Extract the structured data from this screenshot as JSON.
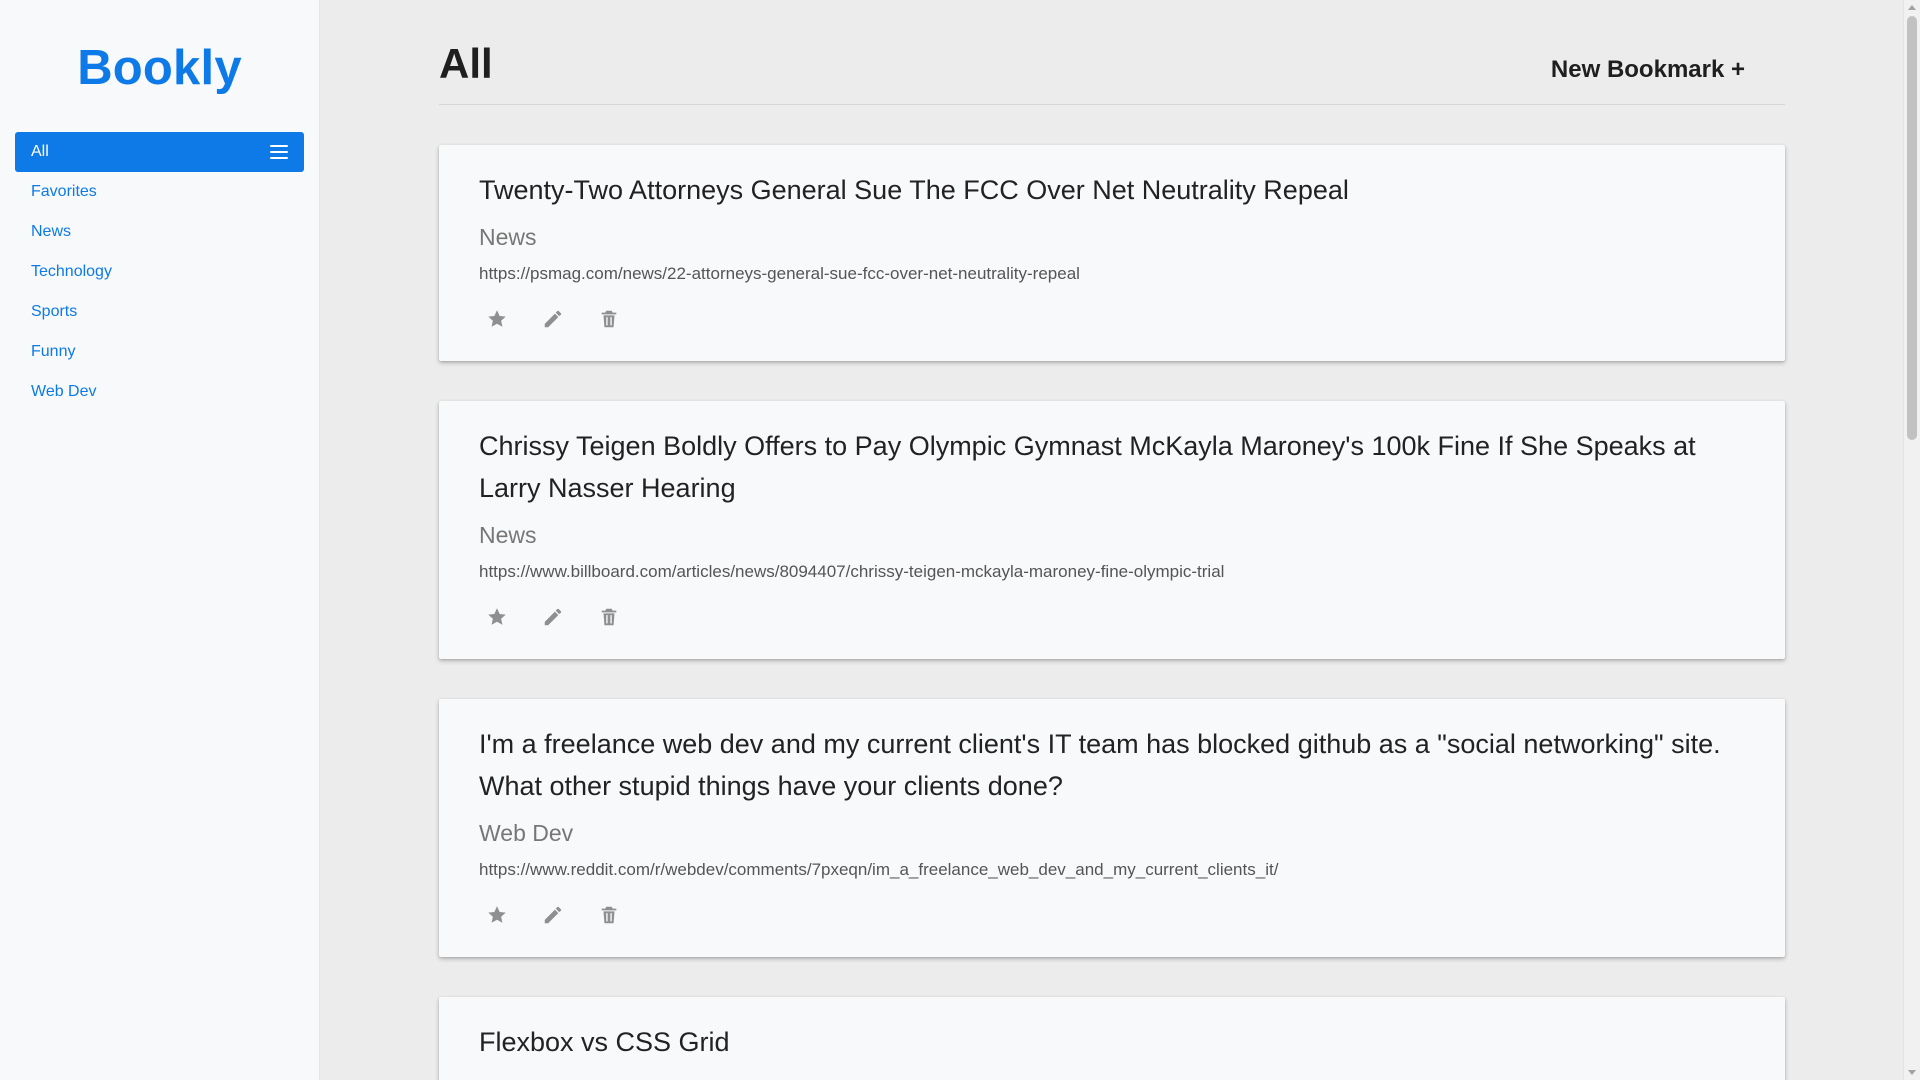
{
  "brand": "Bookly",
  "nav": {
    "items": [
      {
        "label": "All",
        "active": true
      },
      {
        "label": "Favorites"
      },
      {
        "label": "News"
      },
      {
        "label": "Technology"
      },
      {
        "label": "Sports"
      },
      {
        "label": "Funny"
      },
      {
        "label": "Web Dev"
      }
    ]
  },
  "header": {
    "title": "All",
    "new_bookmark": "New Bookmark +"
  },
  "bookmarks": [
    {
      "title": "Twenty-Two Attorneys General Sue The FCC Over Net Neutrality Repeal",
      "category": "News",
      "url": "https://psmag.com/news/22-attorneys-general-sue-fcc-over-net-neutrality-repeal"
    },
    {
      "title": "Chrissy Teigen Boldly Offers to Pay Olympic Gymnast McKayla Maroney's 100k Fine If She Speaks at Larry Nasser Hearing",
      "category": "News",
      "url": "https://www.billboard.com/articles/news/8094407/chrissy-teigen-mckayla-maroney-fine-olympic-trial"
    },
    {
      "title": "I'm a freelance web dev and my current client's IT team has blocked github as a \"social networking\" site. What other stupid things have your clients done?",
      "category": "Web Dev",
      "url": "https://www.reddit.com/r/webdev/comments/7pxeqn/im_a_freelance_web_dev_and_my_current_clients_it/"
    },
    {
      "title": "Flexbox vs CSS Grid",
      "category": "",
      "url": ""
    }
  ],
  "icons": {
    "star": "star-icon",
    "edit": "pencil-icon",
    "delete": "trash-icon",
    "menu": "menu-icon"
  },
  "colors": {
    "accent": "#0d7ae8",
    "icon": "#8f8f8f",
    "background": "#ececec",
    "card": "#f8f9fb"
  }
}
